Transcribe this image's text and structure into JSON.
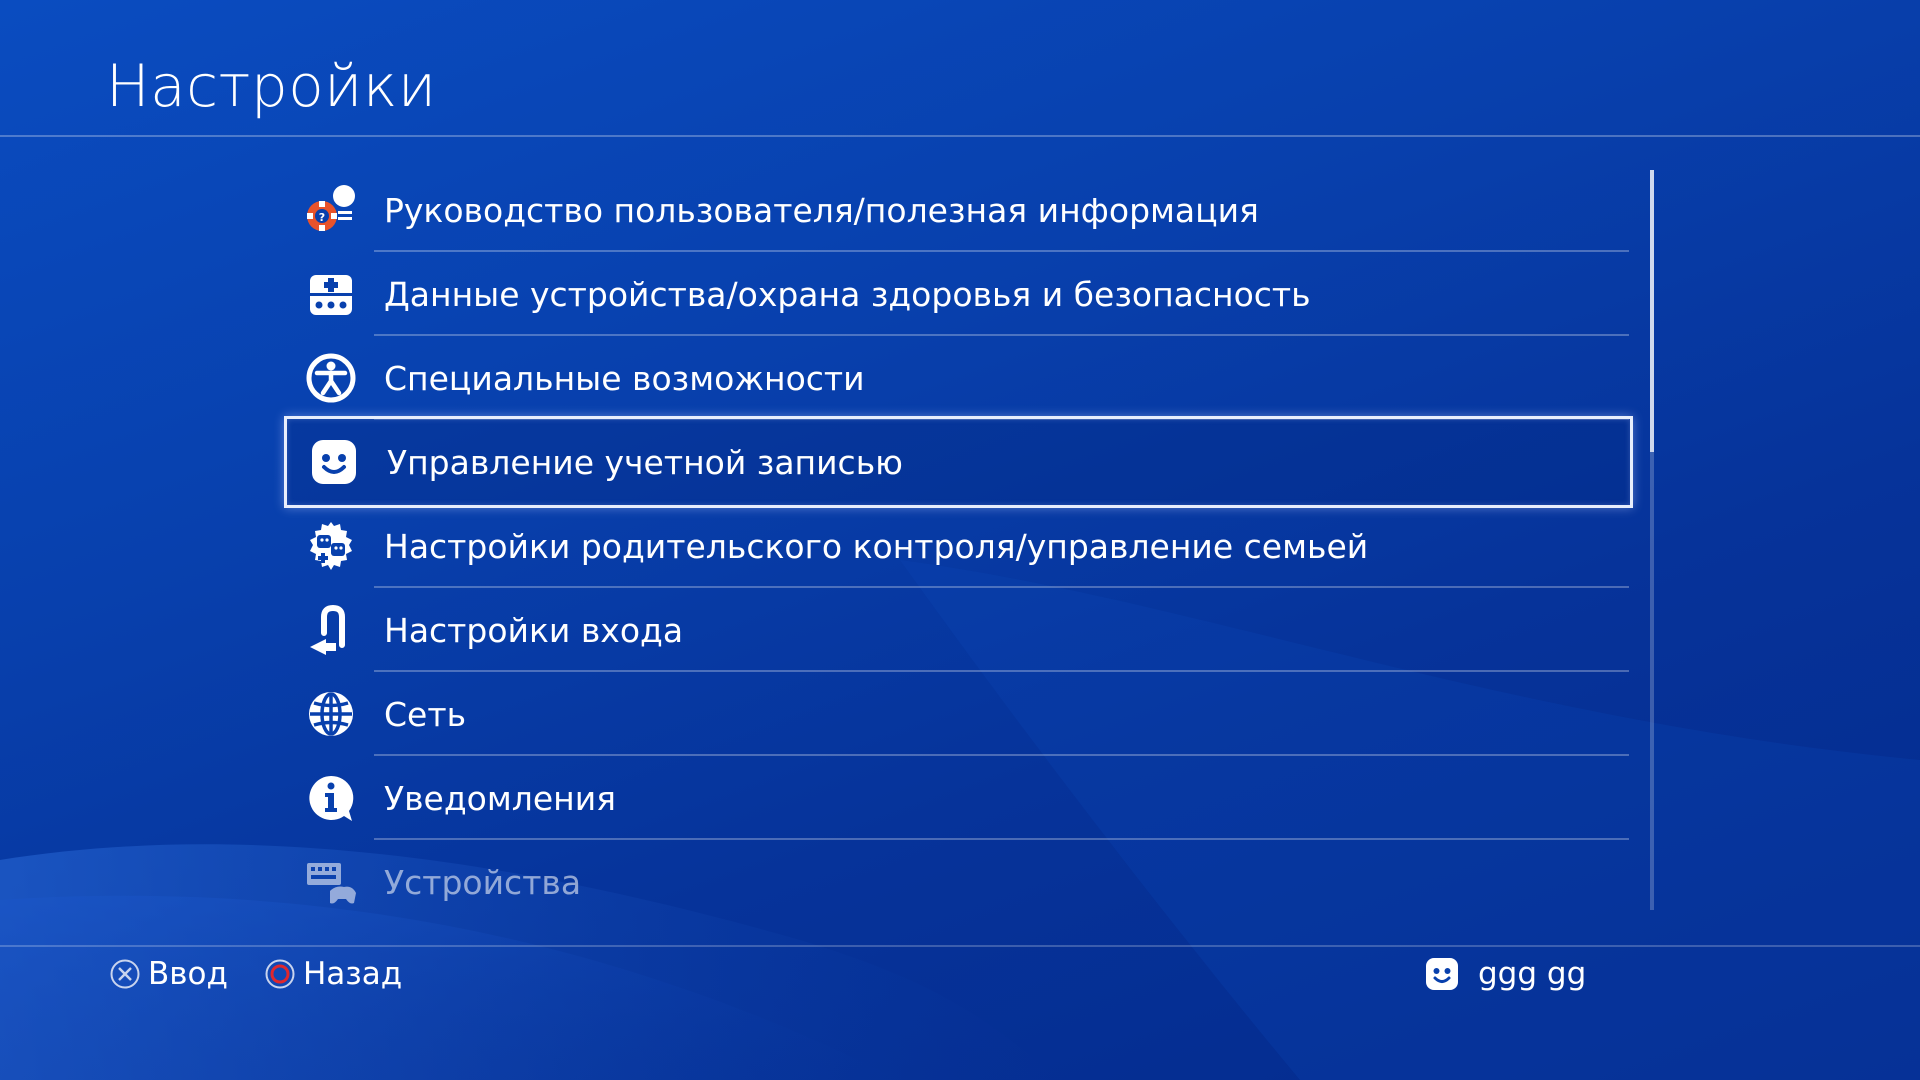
{
  "header": {
    "title": "Настройки"
  },
  "menu": {
    "items": [
      {
        "label": "Руководство пользователя/полезная информация",
        "icon": "user-guide-icon"
      },
      {
        "label": "Данные устройства/охрана здоровья и безопасность",
        "icon": "device-health-icon"
      },
      {
        "label": "Специальные возможности",
        "icon": "accessibility-icon"
      },
      {
        "label": "Управление учетной записью",
        "icon": "account-face-icon",
        "selected": true
      },
      {
        "label": "Настройки родительского контроля/управление семьей",
        "icon": "family-shield-icon"
      },
      {
        "label": "Настройки входа",
        "icon": "login-icon"
      },
      {
        "label": "Сеть",
        "icon": "globe-icon"
      },
      {
        "label": "Уведомления",
        "icon": "info-notification-icon"
      },
      {
        "label": "Устройства",
        "icon": "devices-keyboard-icon"
      }
    ]
  },
  "footer": {
    "enter_label": "Ввод",
    "enter_icon": "cross-button-icon",
    "back_label": "Назад",
    "back_icon": "circle-button-icon",
    "user_name": "ggg gg",
    "user_icon": "user-avatar-face-icon"
  },
  "colors": {
    "background": "#0840ad",
    "circle_button": "#e0272d",
    "lifebuoy": "#e8532b"
  }
}
